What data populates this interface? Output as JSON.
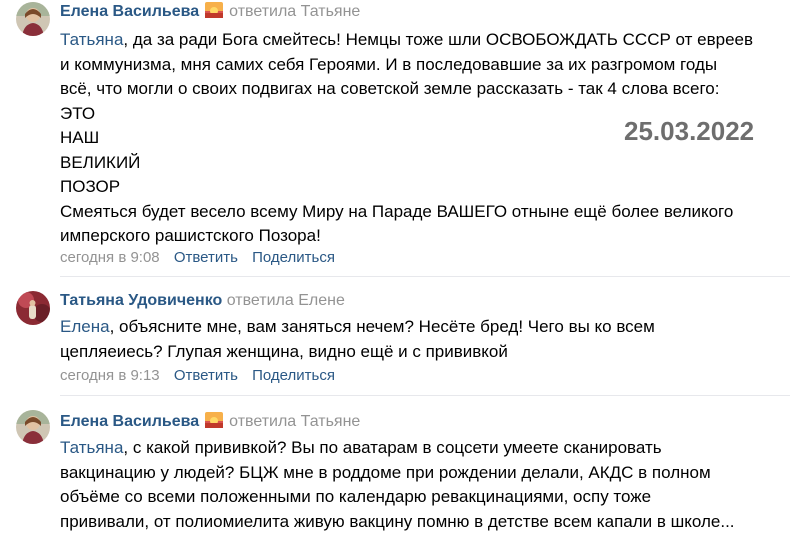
{
  "stamp_date": "25.03.2022",
  "comments": [
    {
      "author": "Елена Васильева",
      "replied": "ответила Татьяне",
      "mention": "Татьяна",
      "lines": [
        ", да за ради Бога смейтесь! Немцы тоже шли ОСВОБОЖДАТЬ СССР от евреев",
        "и коммунизма, мня самих себя Героями. И в последовавшие за их разгромом годы",
        "всё, что могли о своих подвигах на советской земле рассказать - так 4 слова всего:",
        "ЭТО",
        "НАШ",
        "ВЕЛИКИЙ",
        "ПОЗОР",
        "Смеяться будет весело всему Миру на Параде ВАШЕГО отныне ещё более великого",
        "имперского рашистского Позора!"
      ],
      "time": "сегодня в 9:08",
      "reply_label": "Ответить",
      "share_label": "Поделиться"
    },
    {
      "author": "Татьяна Удовиченко",
      "replied": "ответила Елене",
      "mention": "Елена",
      "lines": [
        ", объясните мне, вам заняться нечем? Несёте бред! Чего вы ко всем",
        "цепляеиесь? Глупая женщина, видно ещё и с прививкой"
      ],
      "time": "сегодня в 9:13",
      "reply_label": "Ответить",
      "share_label": "Поделиться"
    },
    {
      "author": "Елена Васильева",
      "replied": "ответила Татьяне",
      "mention": "Татьяна",
      "lines": [
        ", с какой прививкой? Вы по аватарам в соцсети умеете сканировать",
        "вакцинацию у людей? БЦЖ мне в роддоме при рождении делали, АКДС в полном",
        "объёме со всеми положенными по календарю ревакцинациями, оспу тоже",
        "прививали, от полиомиелита живую вакцину помню в детстве всем капали в школе..."
      ]
    }
  ],
  "colors": {
    "link": "#2a5885",
    "muted": "#939393",
    "divider": "#e7e8ec",
    "stamp": "#6e6e6e"
  },
  "icons": {
    "author_badge": "sunset-emoji-icon"
  }
}
